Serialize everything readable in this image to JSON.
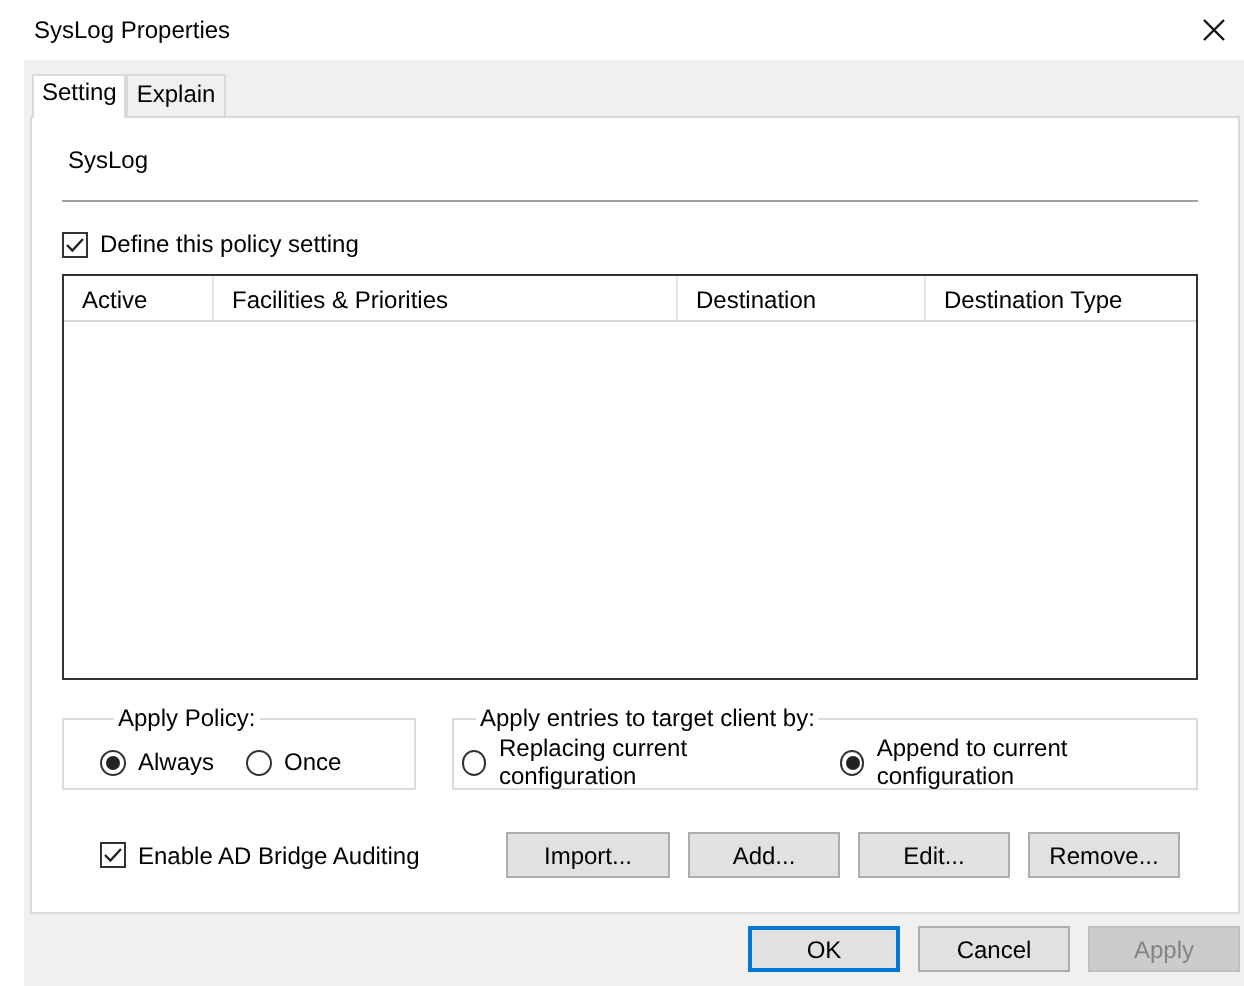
{
  "window": {
    "title": "SysLog Properties"
  },
  "tabs": [
    {
      "label": "Setting",
      "selected": true
    },
    {
      "label": "Explain",
      "selected": false
    }
  ],
  "policy_name": "SysLog",
  "define_policy": {
    "label": "Define this policy setting",
    "checked": true
  },
  "table": {
    "columns": [
      "Active",
      "Facilities & Priorities",
      "Destination",
      "Destination Type"
    ]
  },
  "apply_policy": {
    "title": "Apply Policy:",
    "options": [
      {
        "label": "Always",
        "selected": true
      },
      {
        "label": "Once",
        "selected": false
      }
    ]
  },
  "apply_entries": {
    "title": "Apply entries to target client by:",
    "options": [
      {
        "label": "Replacing current configuration",
        "selected": false
      },
      {
        "label": "Append to current configuration",
        "selected": true
      }
    ]
  },
  "auditing": {
    "label": "Enable AD Bridge Auditing",
    "checked": true
  },
  "list_buttons": [
    "Import...",
    "Add...",
    "Edit...",
    "Remove..."
  ],
  "dialog_buttons": [
    {
      "label": "OK",
      "default": true,
      "disabled": false
    },
    {
      "label": "Cancel",
      "default": false,
      "disabled": false
    },
    {
      "label": "Apply",
      "default": false,
      "disabled": true
    }
  ]
}
